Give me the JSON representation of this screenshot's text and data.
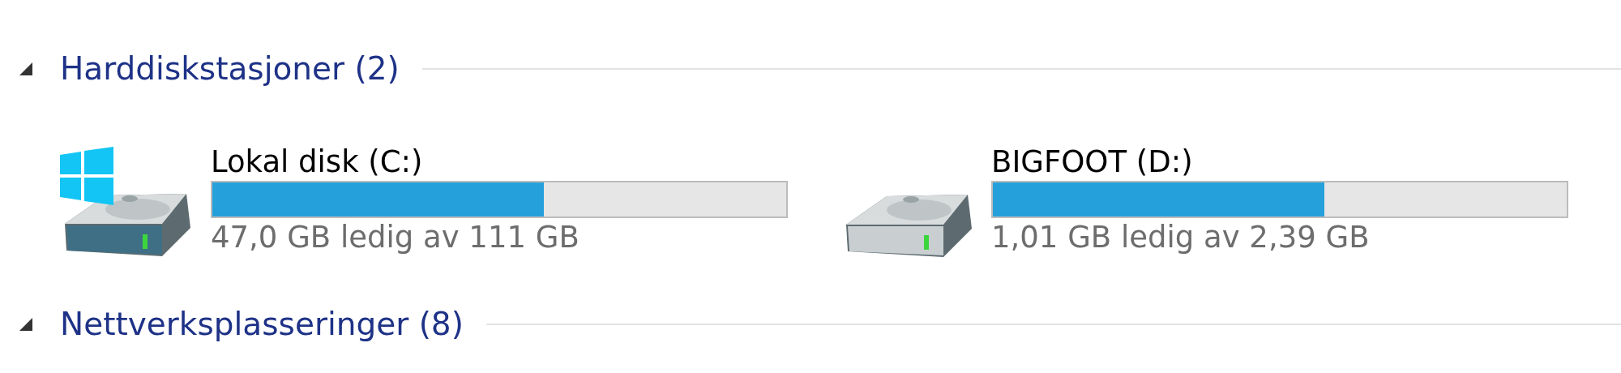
{
  "groups": [
    {
      "title": "Harddiskstasjoner (2)",
      "expanded": true,
      "drives": [
        {
          "kind": "system",
          "name": "Lokal disk (C:)",
          "level": 0.577,
          "reading": "47,0 GB ledig av 111 GB"
        },
        {
          "kind": "drive",
          "name": "BIGFOOT (D:)",
          "level": 0.577,
          "reading": "1,01 GB ledig av 2,39 GB"
        }
      ]
    },
    {
      "title": "Nettverksplasseringer (8)",
      "expanded": true
    }
  ]
}
